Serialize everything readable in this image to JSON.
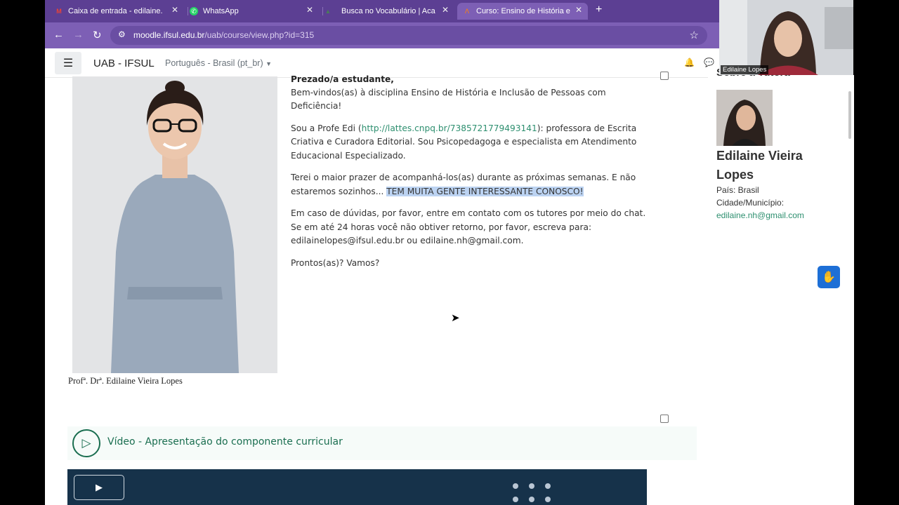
{
  "tabs": [
    {
      "title": "Caixa de entrada - edilaine.nh",
      "icon": "gmail-icon"
    },
    {
      "title": "WhatsApp",
      "icon": "whatsapp-icon"
    },
    {
      "title": "Busca no Vocabulário | Acade",
      "icon": "site-icon"
    },
    {
      "title": "Curso: Ensino de História e In",
      "icon": "moodle-icon",
      "active": true
    }
  ],
  "address": {
    "domain": "moodle.ifsul.edu.br",
    "path": "/uab/course/view.php?id=315"
  },
  "header": {
    "site_name": "UAB - IFSUL",
    "language": "Português - Brasil (pt_br)"
  },
  "content": {
    "greeting": "Prezado/a estudante,",
    "welcome": "Bem-vindos(as) à disciplina Ensino de História e Inclusão de Pessoas com Deficiência!",
    "intro_before": "Sou a Profe Edi (",
    "intro_link": "http://lattes.cnpq.br/7385721779493141",
    "intro_after": "): professora de Escrita Criativa e Curadora Editorial. Sou Psicopedagoga e especialista em Atendimento Educacional Especializado.",
    "p3_text": "Terei o maior prazer de acompanhá-los(as) durante as próximas semanas. E não estaremos sozinhos... ",
    "p3_highlight": "TEM MUITA GENTE INTERESSANTE CONOSCO!",
    "p4": "Em caso de dúvidas, por favor, entre em contato com os tutores por meio do chat. Se em até 24 horas você não obtiver retorno, por favor, escreva para: edilainelopes@ifsul.edu.br ou edilaine.nh@gmail.com.",
    "p5": "Prontos(as)? Vamos?",
    "photo_caption": "Profª.  Drª.  Edilaine Vieira Lopes"
  },
  "activity": {
    "title": "Vídeo - Apresentação do componente curricular"
  },
  "sidebar": {
    "heading": "Sobre a Tutora",
    "name": "Edilaine Vieira Lopes",
    "country": "País: Brasil",
    "city": "Cidade/Município:",
    "email": "edilaine.nh@gmail.com"
  },
  "webcam": {
    "label": "Edilaine Lopes"
  },
  "colors": {
    "browser_frame": "#5c3f93",
    "link": "#2d8f6f",
    "highlight": "#bcd3f2",
    "video_bg": "#16324a"
  }
}
